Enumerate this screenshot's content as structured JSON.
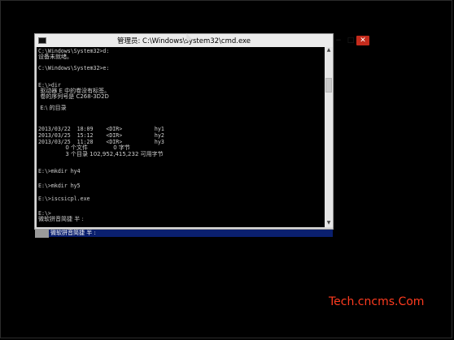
{
  "window": {
    "title": "管理员: C:\\Windows\\system32\\cmd.exe",
    "min_label": "−",
    "max_label": "□",
    "close_label": "✕"
  },
  "console": {
    "lines": [
      "C:\\Windows\\System32>d:",
      "设备未就绪。",
      "",
      "C:\\Windows\\System32>e:",
      "",
      "E:\\>dir",
      " 驱动器 E 中的卷没有标签。",
      " 卷的序列号是 C268-3D2D",
      "",
      " E:\\ 的目录",
      "",
      "2013/03/22  18:09    <DIR>          hy1",
      "2013/03/25  15:12    <DIR>          hy2",
      "2013/03/25  11:28    <DIR>          hy3",
      "               0 个文件              0 字节",
      "               3 个目录 102,952,415,232 可用字节",
      "",
      "E:\\>mkdir hy4",
      "",
      "E:\\>mkdir hy5",
      "",
      "E:\\>iscsicpl.exe",
      "",
      "E:\\>",
      "微软拼音简捷 半 :"
    ]
  },
  "ime": {
    "label": "微软拼音简捷 半 :"
  },
  "watermark": "Tech.cncms.Com",
  "colors": {
    "console_bg": "#000000",
    "console_fg": "#cfcfcf",
    "ime_bar": "#0a1f6e",
    "close_button": "#c42b1c",
    "watermark": "#ff3b1f"
  }
}
